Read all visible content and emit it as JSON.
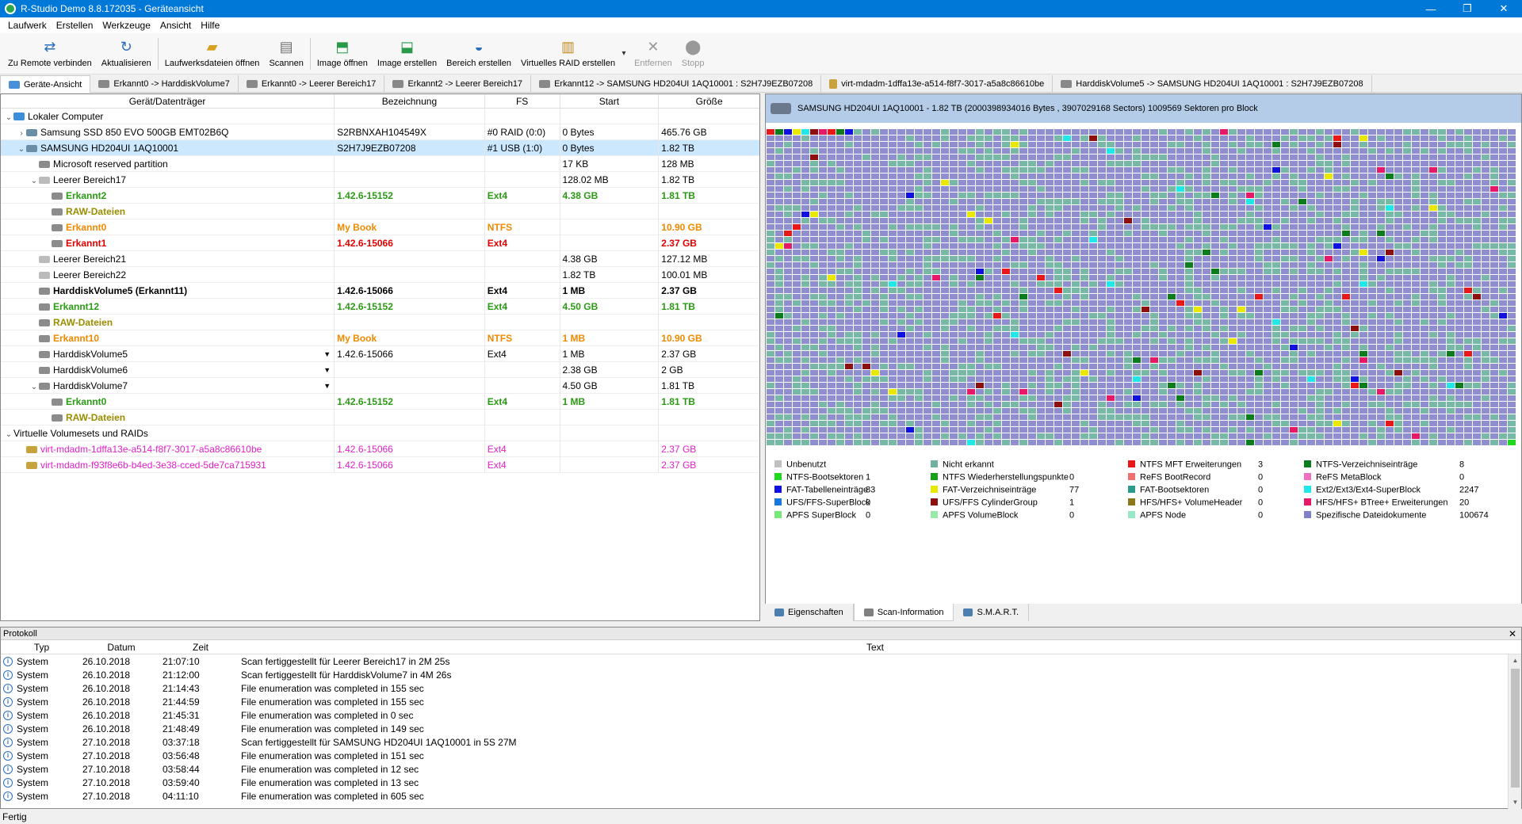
{
  "window": {
    "title": "R-Studio Demo 8.8.172035 - Geräteansicht",
    "minimize": "—",
    "maximize": "❐",
    "close": "✕"
  },
  "menu": [
    "Laufwerk",
    "Erstellen",
    "Werkzeuge",
    "Ansicht",
    "Hilfe"
  ],
  "toolbar": [
    {
      "label": "Zu Remote verbinden",
      "icon": "remote-connect-icon",
      "enabled": true
    },
    {
      "label": "Aktualisieren",
      "icon": "refresh-icon",
      "enabled": true
    },
    {
      "label": "Laufwerksdateien öffnen",
      "icon": "open-drive-files-icon",
      "enabled": true
    },
    {
      "label": "Scannen",
      "icon": "scan-icon",
      "enabled": true
    },
    {
      "label": "Image öffnen",
      "icon": "open-image-icon",
      "enabled": true
    },
    {
      "label": "Image erstellen",
      "icon": "create-image-icon",
      "enabled": true
    },
    {
      "label": "Bereich erstellen",
      "icon": "create-region-icon",
      "enabled": true
    },
    {
      "label": "Virtuelles RAID erstellen",
      "icon": "create-raid-icon",
      "enabled": true
    },
    {
      "label": "Entfernen",
      "icon": "remove-icon",
      "enabled": false
    },
    {
      "label": "Stopp",
      "icon": "stop-icon",
      "enabled": false
    }
  ],
  "tabs": [
    "Geräte-Ansicht",
    "Erkannt0 -> HarddiskVolume7",
    "Erkannt0 -> Leerer Bereich17",
    "Erkannt2 -> Leerer Bereich17",
    "Erkannt12 -> SAMSUNG HD204UI 1AQ10001 : S2H7J9EZB07208",
    "virt-mdadm-1dffa13e-a514-f8f7-3017-a5a8c86610be",
    "HarddiskVolume5 -> SAMSUNG HD204UI 1AQ10001 : S2H7J9EZB07208"
  ],
  "device_table": {
    "headers": [
      "Gerät/Datenträger",
      "Bezeichnung",
      "FS",
      "Start",
      "Größe"
    ],
    "rows": [
      {
        "level": 0,
        "toggle": "⌄",
        "icon": "pc",
        "name": "Lokaler Computer",
        "label": "",
        "fs": "",
        "start": "",
        "size": "",
        "style": ""
      },
      {
        "level": 1,
        "toggle": "›",
        "icon": "hdd",
        "name": "Samsung SSD 850 EVO 500GB EMT02B6Q",
        "label": "S2RBNXAH104549X",
        "fs": "#0 RAID (0:0)",
        "start": "0 Bytes",
        "size": "465.76 GB",
        "style": ""
      },
      {
        "level": 1,
        "toggle": "⌄",
        "icon": "hdd",
        "name": "SAMSUNG HD204UI 1AQ10001",
        "label": "S2H7J9EZB07208",
        "fs": "#1 USB (1:0)",
        "start": "0 Bytes",
        "size": "1.82 TB",
        "style": "",
        "selected": true
      },
      {
        "level": 2,
        "toggle": "",
        "icon": "vol",
        "name": "Microsoft reserved partition",
        "label": "",
        "fs": "",
        "start": "17 KB",
        "size": "128 MB",
        "style": ""
      },
      {
        "level": 2,
        "toggle": "⌄",
        "icon": "part",
        "name": "Leerer Bereich17",
        "label": "",
        "fs": "",
        "start": "128.02 MB",
        "size": "1.82 TB",
        "style": ""
      },
      {
        "level": 3,
        "toggle": "",
        "icon": "vol",
        "name": "Erkannt2",
        "label": "1.42.6-15152",
        "fs": "Ext4",
        "start": "4.38 GB",
        "size": "1.81 TB",
        "style": "green"
      },
      {
        "level": 3,
        "toggle": "",
        "icon": "vol",
        "name": "RAW-Dateien",
        "label": "",
        "fs": "",
        "start": "",
        "size": "",
        "style": "olive"
      },
      {
        "level": 3,
        "toggle": "",
        "icon": "vol",
        "name": "Erkannt0",
        "label": "My Book",
        "fs": "NTFS",
        "start": "",
        "size": "10.90 GB",
        "style": "orange"
      },
      {
        "level": 3,
        "toggle": "",
        "icon": "vol",
        "name": "Erkannt1",
        "label": "1.42.6-15066",
        "fs": "Ext4",
        "start": "",
        "size": "2.37 GB",
        "style": "red"
      },
      {
        "level": 2,
        "toggle": "",
        "icon": "part",
        "name": "Leerer Bereich21",
        "label": "",
        "fs": "",
        "start": "4.38 GB",
        "size": "127.12 MB",
        "style": ""
      },
      {
        "level": 2,
        "toggle": "",
        "icon": "part",
        "name": "Leerer Bereich22",
        "label": "",
        "fs": "",
        "start": "1.82 TB",
        "size": "100.01 MB",
        "style": ""
      },
      {
        "level": 2,
        "toggle": "",
        "icon": "vol",
        "name": "HarddiskVolume5 (Erkannt11)",
        "label": "1.42.6-15066",
        "fs": "Ext4",
        "start": "1 MB",
        "size": "2.37 GB",
        "style": "bold"
      },
      {
        "level": 2,
        "toggle": "",
        "icon": "vol",
        "name": "Erkannt12",
        "label": "1.42.6-15152",
        "fs": "Ext4",
        "start": "4.50 GB",
        "size": "1.81 TB",
        "style": "green"
      },
      {
        "level": 2,
        "toggle": "",
        "icon": "vol",
        "name": "RAW-Dateien",
        "label": "",
        "fs": "",
        "start": "",
        "size": "",
        "style": "olive"
      },
      {
        "level": 2,
        "toggle": "",
        "icon": "vol",
        "name": "Erkannt10",
        "label": "My Book",
        "fs": "NTFS",
        "start": "1 MB",
        "size": "10.90 GB",
        "style": "orange"
      },
      {
        "level": 2,
        "toggle": "",
        "icon": "vol",
        "name": "HarddiskVolume5",
        "label": "1.42.6-15066",
        "fs": "Ext4",
        "start": "1 MB",
        "size": "2.37 GB",
        "style": "",
        "dropdown": true
      },
      {
        "level": 2,
        "toggle": "",
        "icon": "vol",
        "name": "HarddiskVolume6",
        "label": "",
        "fs": "",
        "start": "2.38 GB",
        "size": "2 GB",
        "style": "",
        "dropdown": true
      },
      {
        "level": 2,
        "toggle": "⌄",
        "icon": "vol",
        "name": "HarddiskVolume7",
        "label": "",
        "fs": "",
        "start": "4.50 GB",
        "size": "1.81 TB",
        "style": "",
        "dropdown": true
      },
      {
        "level": 3,
        "toggle": "",
        "icon": "vol",
        "name": "Erkannt0",
        "label": "1.42.6-15152",
        "fs": "Ext4",
        "start": "1 MB",
        "size": "1.81 TB",
        "style": "green"
      },
      {
        "level": 3,
        "toggle": "",
        "icon": "vol",
        "name": "RAW-Dateien",
        "label": "",
        "fs": "",
        "start": "",
        "size": "",
        "style": "olive"
      },
      {
        "level": 0,
        "toggle": "⌄",
        "icon": "",
        "name": "Virtuelle Volumesets und RAIDs",
        "label": "",
        "fs": "",
        "start": "",
        "size": "",
        "style": ""
      },
      {
        "level": 1,
        "toggle": "",
        "icon": "raid",
        "name": "virt-mdadm-1dffa13e-a514-f8f7-3017-a5a8c86610be",
        "label": "1.42.6-15066",
        "fs": "Ext4",
        "start": "",
        "size": "2.37 GB",
        "style": "magenta"
      },
      {
        "level": 1,
        "toggle": "",
        "icon": "raid",
        "name": "virt-mdadm-f93f8e6b-b4ed-3e38-cced-5de7ca715931",
        "label": "1.42.6-15066",
        "fs": "Ext4",
        "start": "",
        "size": "2.37 GB",
        "style": "magenta"
      }
    ]
  },
  "disk_map": {
    "header": "SAMSUNG HD204UI 1AQ10001 - 1.82 TB (2000398934016 Bytes , 3907029168 Sectors) 1009569 Sektoren pro Block",
    "colors": {
      "base": "#8f8fcf",
      "alt": "#77b8a6"
    }
  },
  "legend": [
    {
      "name": "Unbenutzt",
      "value": "",
      "color": "#c0c0c0"
    },
    {
      "name": "Nicht erkannt",
      "value": "",
      "color": "#6fb0a0"
    },
    {
      "name": "NTFS MFT Erweiterungen",
      "value": "3",
      "color": "#e81818"
    },
    {
      "name": "NTFS-Verzeichniseinträge",
      "value": "8",
      "color": "#0c7c1c"
    },
    {
      "name": "NTFS-Bootsektoren",
      "value": "1",
      "color": "#20d820"
    },
    {
      "name": "NTFS Wiederherstellungspunkte",
      "value": "0",
      "color": "#18a018"
    },
    {
      "name": "ReFS BootRecord",
      "value": "0",
      "color": "#f07070"
    },
    {
      "name": "ReFS MetaBlock",
      "value": "0",
      "color": "#f070c0"
    },
    {
      "name": "FAT-Tabelleneinträge",
      "value": "83",
      "color": "#1010e0"
    },
    {
      "name": "FAT-Verzeichniseinträge",
      "value": "77",
      "color": "#e8e800"
    },
    {
      "name": "FAT-Bootsektoren",
      "value": "0",
      "color": "#2a9a8a"
    },
    {
      "name": "Ext2/Ext3/Ext4-SuperBlock",
      "value": "2247",
      "color": "#20e8e8"
    },
    {
      "name": "UFS/FFS-SuperBlock",
      "value": "0",
      "color": "#1878e0"
    },
    {
      "name": "UFS/FFS CylinderGroup",
      "value": "1",
      "color": "#8c1010"
    },
    {
      "name": "HFS/HFS+ VolumeHeader",
      "value": "0",
      "color": "#8c7818"
    },
    {
      "name": "HFS/HFS+ BTree+ Erweiterungen",
      "value": "20",
      "color": "#e81868"
    },
    {
      "name": "APFS SuperBlock",
      "value": "0",
      "color": "#78e878"
    },
    {
      "name": "APFS VolumeBlock",
      "value": "0",
      "color": "#98e8a8"
    },
    {
      "name": "APFS Node",
      "value": "0",
      "color": "#98e8c8"
    },
    {
      "name": "Spezifische Dateidokumente",
      "value": "100674",
      "color": "#8080c8"
    }
  ],
  "right_tabs": [
    "Eigenschaften",
    "Scan-Information",
    "S.M.A.R.T."
  ],
  "log": {
    "title": "Protokoll",
    "close": "✕",
    "headers": [
      "Typ",
      "Datum",
      "Zeit",
      "Text"
    ],
    "rows": [
      {
        "type": "System",
        "date": "26.10.2018",
        "time": "21:07:10",
        "text": "Scan fertiggestellt für Leerer Bereich17 in 2M 25s"
      },
      {
        "type": "System",
        "date": "26.10.2018",
        "time": "21:12:00",
        "text": "Scan fertiggestellt für HarddiskVolume7 in 4M 26s"
      },
      {
        "type": "System",
        "date": "26.10.2018",
        "time": "21:14:43",
        "text": "File enumeration was completed in 155 sec"
      },
      {
        "type": "System",
        "date": "26.10.2018",
        "time": "21:44:59",
        "text": "File enumeration was completed in 155 sec"
      },
      {
        "type": "System",
        "date": "26.10.2018",
        "time": "21:45:31",
        "text": "File enumeration was completed in 0 sec"
      },
      {
        "type": "System",
        "date": "26.10.2018",
        "time": "21:48:49",
        "text": "File enumeration was completed in 149 sec"
      },
      {
        "type": "System",
        "date": "27.10.2018",
        "time": "03:37:18",
        "text": "Scan fertiggestellt für SAMSUNG HD204UI 1AQ10001 in 5S 27M"
      },
      {
        "type": "System",
        "date": "27.10.2018",
        "time": "03:56:48",
        "text": "File enumeration was completed in 151 sec"
      },
      {
        "type": "System",
        "date": "27.10.2018",
        "time": "03:58:44",
        "text": "File enumeration was completed in 12 sec"
      },
      {
        "type": "System",
        "date": "27.10.2018",
        "time": "03:59:40",
        "text": "File enumeration was completed in 13 sec"
      },
      {
        "type": "System",
        "date": "27.10.2018",
        "time": "04:11:10",
        "text": "File enumeration was completed in 605 sec"
      }
    ]
  },
  "status": "Fertig"
}
